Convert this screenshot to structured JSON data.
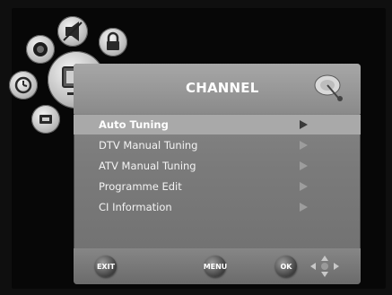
{
  "menu": {
    "title": "CHANNEL",
    "items": [
      {
        "label": "Auto Tuning",
        "selected": true
      },
      {
        "label": "DTV Manual Tuning",
        "selected": false
      },
      {
        "label": "ATV Manual Tuning",
        "selected": false
      },
      {
        "label": "Programme Edit",
        "selected": false
      },
      {
        "label": "CI Information",
        "selected": false
      }
    ]
  },
  "footer": {
    "exit_label": "EXIT",
    "menu_label": "MENU",
    "ok_label": "OK"
  },
  "category_icons": [
    "picture-icon",
    "sound-icon",
    "clock-icon",
    "lock-icon",
    "setup-icon",
    "channel-icon"
  ],
  "colors": {
    "panel": "#7b7b7b",
    "selected_row": "#a9a9a9",
    "text": "#ffffff"
  }
}
